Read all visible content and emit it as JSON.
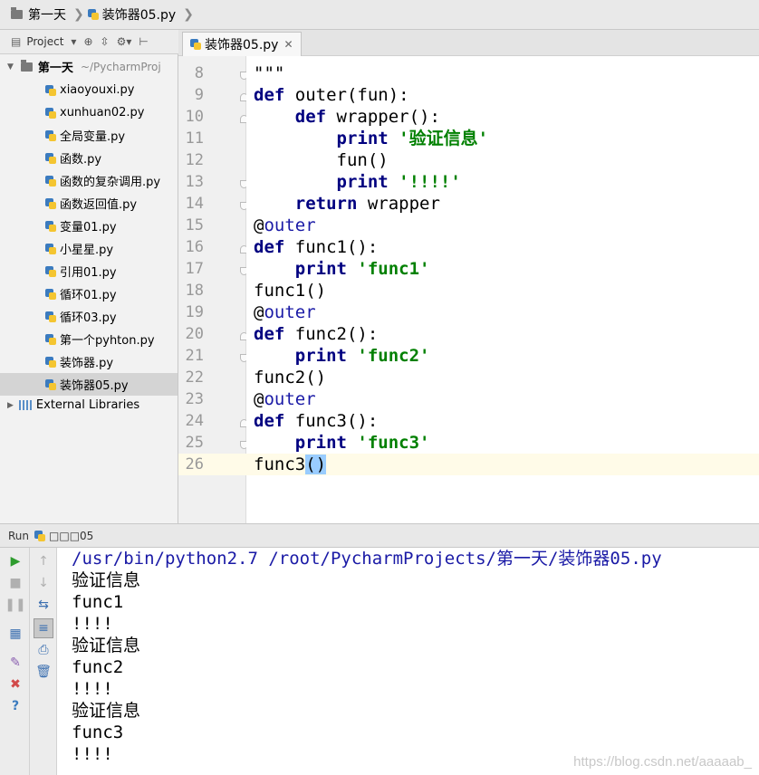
{
  "breadcrumb": {
    "project": "第一天",
    "file": "装饰器05.py"
  },
  "project_panel": {
    "label": "Project",
    "root_name": "第一天",
    "root_path": "~/PycharmProj",
    "files": [
      "xiaoyouxi.py",
      "xunhuan02.py",
      "全局变量.py",
      "函数.py",
      "函数的复杂调用.py",
      "函数返回值.py",
      "变量01.py",
      "小星星.py",
      "引用01.py",
      "循环01.py",
      "循环03.py",
      "第一个pyhton.py",
      "装饰器.py",
      "装饰器05.py"
    ],
    "selected_file": "装饰器05.py",
    "external_libraries": "External Libraries"
  },
  "editor": {
    "tab_label": "装饰器05.py",
    "lines": [
      {
        "n": "8",
        "t": "\"\"\""
      },
      {
        "n": "9",
        "t": "def outer(fun):"
      },
      {
        "n": "10",
        "t": "    def wrapper():"
      },
      {
        "n": "11",
        "t": "        print '验证信息'"
      },
      {
        "n": "12",
        "t": "        fun()"
      },
      {
        "n": "13",
        "t": "        print '!!!!'"
      },
      {
        "n": "14",
        "t": "    return wrapper"
      },
      {
        "n": "15",
        "t": "@outer"
      },
      {
        "n": "16",
        "t": "def func1():"
      },
      {
        "n": "17",
        "t": "    print 'func1'"
      },
      {
        "n": "18",
        "t": "func1()"
      },
      {
        "n": "19",
        "t": "@outer"
      },
      {
        "n": "20",
        "t": "def func2():"
      },
      {
        "n": "21",
        "t": "    print 'func2'"
      },
      {
        "n": "22",
        "t": "func2()"
      },
      {
        "n": "23",
        "t": "@outer"
      },
      {
        "n": "24",
        "t": "def func3():"
      },
      {
        "n": "25",
        "t": "    print 'func3'"
      },
      {
        "n": "26",
        "t": "func3()"
      }
    ]
  },
  "run": {
    "label": "Run",
    "config_name": "□□□05",
    "output": [
      "/usr/bin/python2.7 /root/PycharmProjects/第一天/装饰器05.py",
      "验证信息",
      "func1",
      "!!!!",
      "验证信息",
      "func2",
      "!!!!",
      "验证信息",
      "func3",
      "!!!!"
    ]
  },
  "watermark": "https://blog.csdn.net/aaaaab_",
  "colors": {
    "keyword": "#000080",
    "string": "#008000",
    "decorator": "#1a1aa6",
    "current_line": "#fffbe8"
  }
}
